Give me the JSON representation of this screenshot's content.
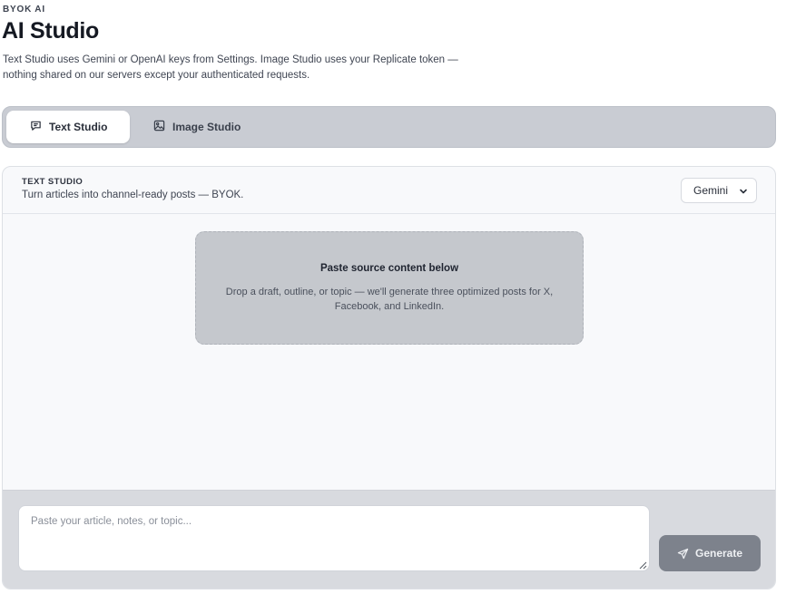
{
  "header": {
    "eyebrow": "BYOK AI",
    "title": "AI Studio",
    "subtitle": "Text Studio uses Gemini or OpenAI keys from Settings. Image Studio uses your Replicate token — nothing shared on our servers except your authenticated requests."
  },
  "tabs": [
    {
      "label": "Text Studio",
      "icon": "message-icon",
      "active": true
    },
    {
      "label": "Image Studio",
      "icon": "image-icon",
      "active": false
    }
  ],
  "card": {
    "kicker": "TEXT STUDIO",
    "description": "Turn articles into channel-ready posts — BYOK.",
    "model": {
      "selected": "Gemini"
    }
  },
  "empty_state": {
    "title": "Paste source content below",
    "text": "Drop a draft, outline, or topic — we'll generate three optimized posts for X, Facebook, and LinkedIn."
  },
  "composer": {
    "placeholder": "Paste your article, notes, or topic...",
    "value": "",
    "generate_label": "Generate",
    "generate_icon": "send-icon"
  },
  "colors": {
    "tab_strip": "#c9ccd3",
    "composer_bg": "#d8dadf",
    "generate_button": "#7d828c",
    "empty_box": "#c5c8cd"
  }
}
